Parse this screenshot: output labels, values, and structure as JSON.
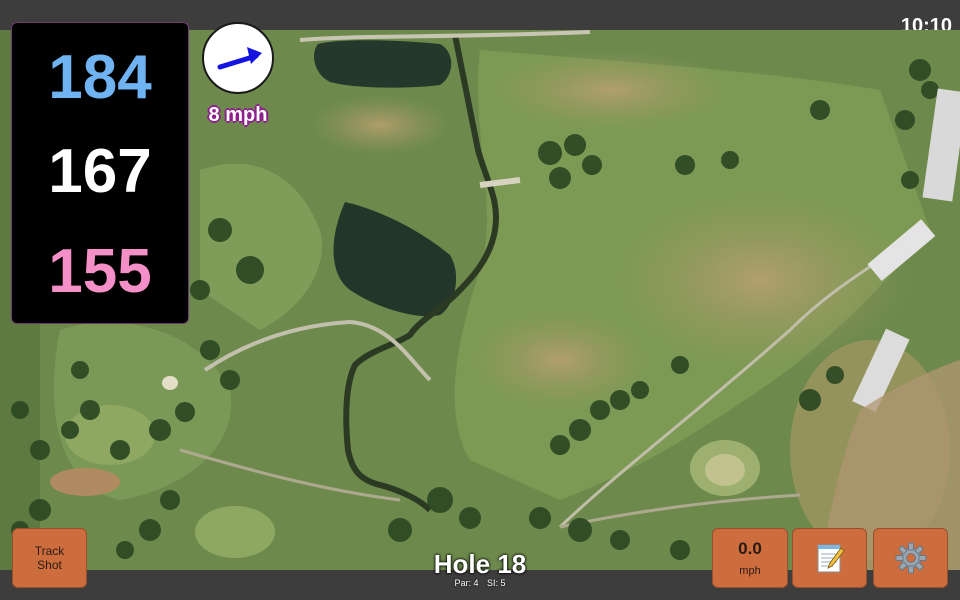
{
  "status_bar": {
    "time": "10:10"
  },
  "distances": {
    "back": {
      "value": "184",
      "color": "#6fb3f2"
    },
    "middle": {
      "value": "167",
      "color": "#ffffff"
    },
    "front": {
      "value": "155",
      "color": "#f48fc7"
    }
  },
  "wind": {
    "speed_label": "8 mph",
    "arrow_color": "#1414e0",
    "icon": "wind-direction-arrow"
  },
  "hole": {
    "title": "Hole 18",
    "par": "Par: 4",
    "stroke_index": "SI: 5"
  },
  "buttons": {
    "track_shot_line1": "Track",
    "track_shot_line2": "Shot",
    "speed_value": "0.0",
    "speed_unit": "mph",
    "notes_icon": "notepad-icon",
    "settings_icon": "gear-icon"
  },
  "colors": {
    "button_bg": "#cd6d3e",
    "panel_bg": "#000000",
    "bar_bg": "#3d3d3d"
  }
}
